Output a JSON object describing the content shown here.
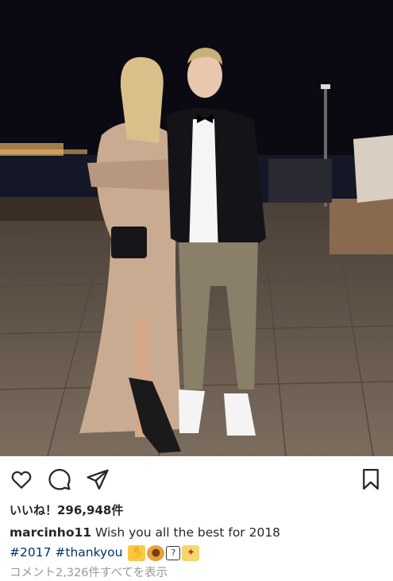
{
  "post": {
    "likes_text": "いいね！296,948件",
    "username": "marcinho11",
    "caption_text": " Wish you all the best for 2018",
    "hashtag_1": "#2017",
    "hashtag_2": "#thankyou",
    "emoji": [
      "raising-hands",
      "lion",
      "question-box",
      "party-popper"
    ],
    "comments_link": "コメント2,326件すべてを表示"
  },
  "colors": {
    "text": "#262626",
    "hashtag": "#003569",
    "muted": "#999999",
    "night_sky": "#0b0a12",
    "ground": "#6e6052"
  },
  "icons": {
    "like": "heart-icon",
    "comment": "comment-icon",
    "share": "share-icon",
    "save": "bookmark-icon"
  }
}
